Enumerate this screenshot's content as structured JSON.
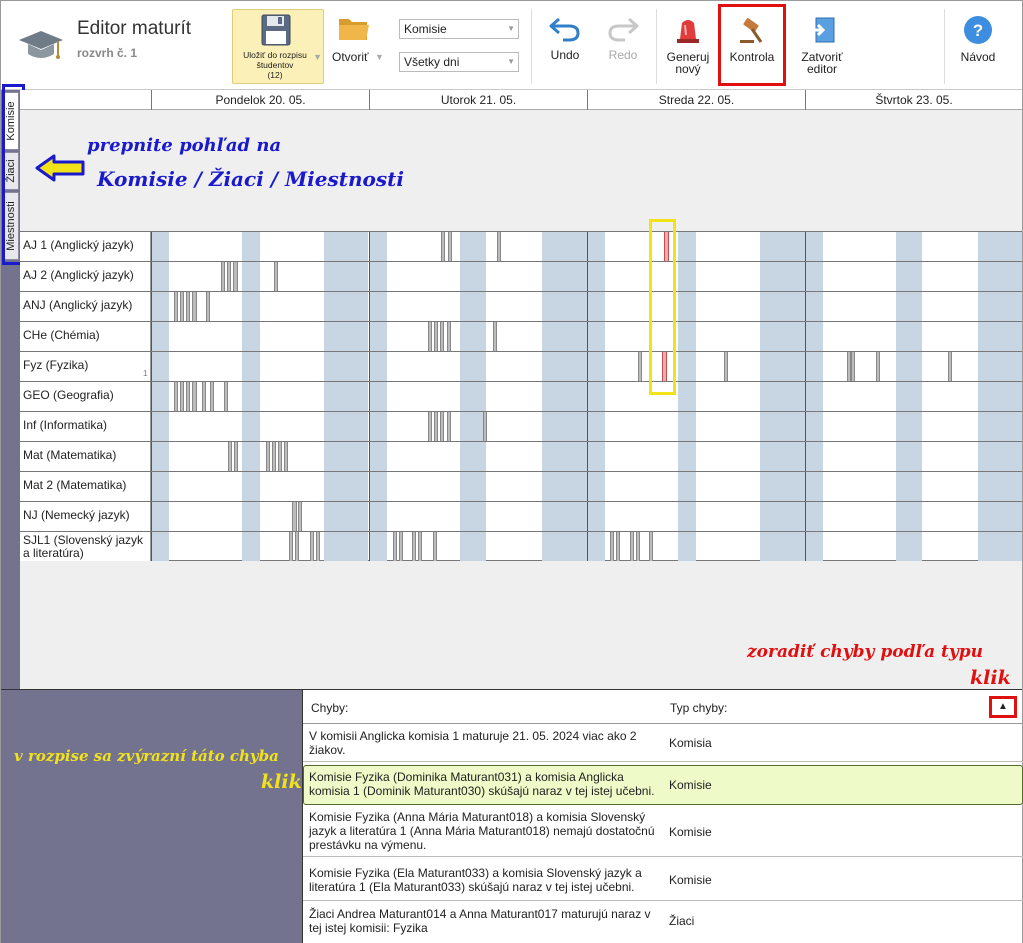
{
  "app": {
    "title": "Editor maturít",
    "subtitle": "rozvrh č. 1"
  },
  "toolbar": {
    "save_label_line1": "Uložiť do rozpisu",
    "save_label_line2": "študentov",
    "save_count": "(12)",
    "open_label": "Otvoriť",
    "select_view": "Komisie",
    "select_days": "Všetky dni",
    "undo_label": "Undo",
    "redo_label": "Redo",
    "generate_line1": "Generuj",
    "generate_line2": "nový",
    "check_label": "Kontrola",
    "close_line1": "Zatvoriť",
    "close_line2": "editor",
    "help_label": "Návod"
  },
  "side_tabs": [
    "Komisie",
    "Žiaci",
    "Miestnosti"
  ],
  "days": [
    "Pondelok 20. 05.",
    "Utorok 21. 05.",
    "Streda 22. 05.",
    "Štvrtok 23. 05."
  ],
  "rows": [
    {
      "label": "AJ 1 (Anglický jazyk)"
    },
    {
      "label": "AJ 2 (Anglický jazyk)"
    },
    {
      "label": "ANJ (Anglický jazyk)"
    },
    {
      "label": "CHe (Chémia)"
    },
    {
      "label": "Fyz (Fyzika)",
      "count": "1"
    },
    {
      "label": "GEO (Geografia)"
    },
    {
      "label": "Inf (Informatika)"
    },
    {
      "label": "Mat (Matematika)"
    },
    {
      "label": "Mat 2 (Matematika)"
    },
    {
      "label": "NJ (Nemecký jazyk)"
    },
    {
      "label_line1": "SJL1 (Slovenský jazyk",
      "label_line2": "a literatúra)"
    }
  ],
  "errors": {
    "col_message": "Chyby:",
    "col_type": "Typ chyby:",
    "sort_icon": "▲",
    "items": [
      {
        "message": "V komisii Anglicka komisia 1 maturuje 21. 05. 2024 viac ako 2 žiakov.",
        "type": "Komisia"
      },
      {
        "message": "Komisie Fyzika (Dominika Maturant031) a komisia Anglicka komisia 1 (Dominik Maturant030) skúšajú naraz v tej istej učebni.",
        "type": "Komisie"
      },
      {
        "message": "Komisie Fyzika (Anna Mária Maturant018) a komisia Slovenský jazyk a literatúra 1 (Anna Mária Maturant018) nemajú dostatočnú prestávku na výmenu.",
        "type": "Komisie"
      },
      {
        "message": "Komisie Fyzika (Ela Maturant033) a komisia Slovenský jazyk a literatúra 1 (Ela Maturant033) skúšajú naraz v tej istej učebni.",
        "type": "Komisie"
      },
      {
        "message": "Žiaci Andrea Maturant014 a Anna Maturant017 maturujú naraz v tej istej komisii: Fyzika",
        "type": "Žiaci"
      }
    ]
  },
  "annotations": {
    "switch_line1": "prepnite pohľad na",
    "switch_line2": "Komisie / Žiaci / Miestnosti",
    "sort_line1": "zoradiť chyby podľa typu",
    "sort_line2": "klik",
    "highlight_line1": "v rozpise sa zvýrazní táto chyba",
    "highlight_line2": "klik"
  },
  "colors": {
    "panel": "#737390",
    "highlight_red": "#e01010",
    "highlight_blue": "#1a1acc",
    "highlight_yellow": "#f2e21a",
    "selected_row": "#eefac8",
    "schedule_band": "#c8d5e2"
  }
}
